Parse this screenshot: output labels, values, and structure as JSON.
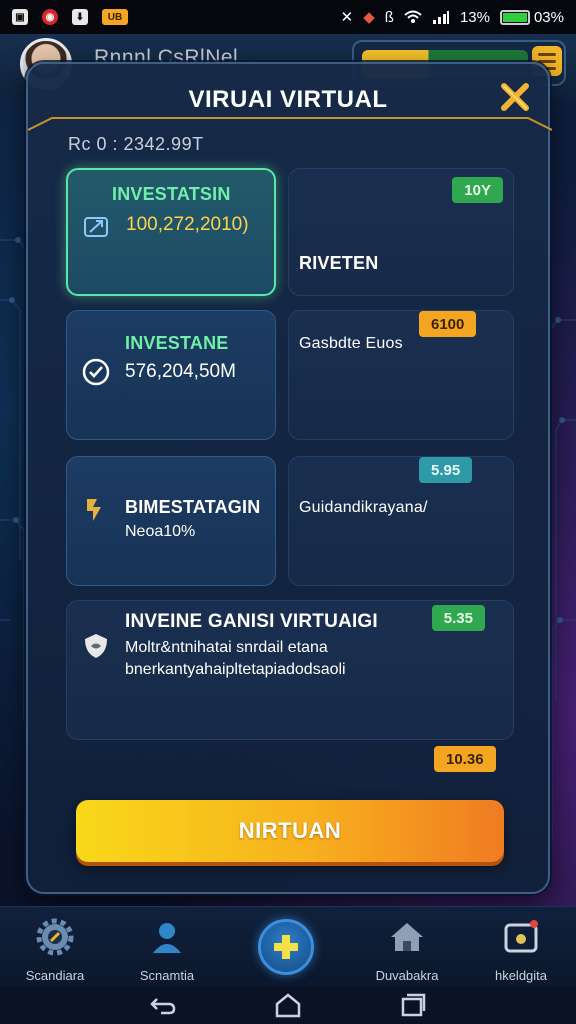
{
  "status_bar": {
    "right_text": "13%",
    "battery_text": "03%"
  },
  "app_header": {
    "title": "Rnnnl CsRlNel ..."
  },
  "modal": {
    "title": "VIRUAI VIRTUAL",
    "balance": "Rc 0 : 2342.99T",
    "cards": [
      {
        "title": "INVESTATSIN",
        "value": "100,272,2010)"
      },
      {
        "title": "RIVETEN",
        "badge": "10Y"
      },
      {
        "title": "INVESTANE",
        "value": "576,204,50M"
      },
      {
        "title": "Gasbdte Euos",
        "badge": "6100"
      },
      {
        "title": "BIMESTATAGIN",
        "value": "Neoa10%"
      },
      {
        "title": "Guidandikrayana/",
        "badge": "5.95"
      },
      {
        "title": "INVEINE GANISI VIRTUAIGI",
        "line1": "Moltr&ntnihatai snrdail etana",
        "line2": "bnerkantyahaipltetapiadodsaoli",
        "badge": "5.35"
      }
    ],
    "extra_badge": "10.36",
    "cta_label": "NIRTUAN"
  },
  "bottom_nav": {
    "items": [
      {
        "label": "Scandiara",
        "icon": "gear-icon"
      },
      {
        "label": "Scnamtia",
        "icon": "user-icon"
      },
      {
        "label": "",
        "icon": "plus-icon"
      },
      {
        "label": "Duvabakra",
        "icon": "home-icon"
      },
      {
        "label": "hkeldgita",
        "icon": "wallet-icon"
      }
    ]
  },
  "colors": {
    "accent_green": "#5ee6a4",
    "cta_start": "#f8d81a",
    "cta_end": "#f07b22",
    "badge_orange": "#f4a623",
    "badge_green": "#2fa84f"
  }
}
